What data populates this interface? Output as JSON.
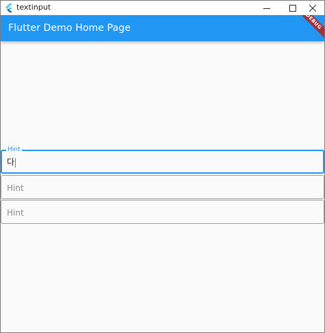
{
  "window": {
    "title": "textinput",
    "icon": "flutter-icon"
  },
  "appbar": {
    "title": "Flutter Demo Home Page",
    "color": "#2196f3",
    "debug_banner": "DEBUG",
    "debug_banner_color": "#a3303b"
  },
  "fields": [
    {
      "label": "Hint",
      "value": "다",
      "focused": true
    },
    {
      "label": "",
      "placeholder": "Hint",
      "value": ""
    },
    {
      "label": "",
      "placeholder": "Hint",
      "value": ""
    }
  ],
  "colors": {
    "accent": "#2196f3",
    "background": "#fafafa",
    "border": "#9e9e9e"
  }
}
